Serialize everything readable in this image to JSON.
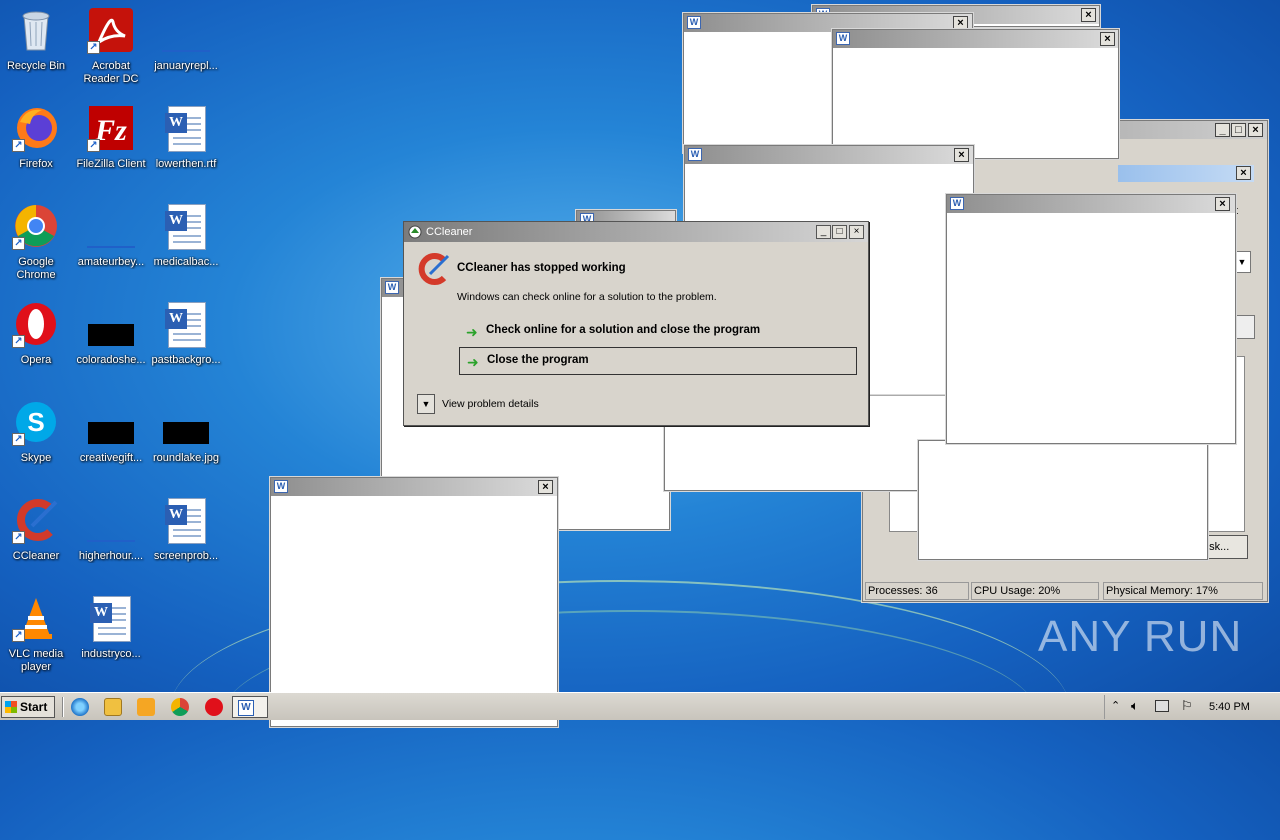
{
  "desktop_icons": [
    {
      "label": "Recycle Bin",
      "icon": "recycle-bin-icon"
    },
    {
      "label": "Acrobat Reader DC",
      "icon": "acrobat-icon"
    },
    {
      "label": "januaryrepl...",
      "icon": "file-icon"
    },
    {
      "label": "Firefox",
      "icon": "firefox-icon"
    },
    {
      "label": "FileZilla Client",
      "icon": "filezilla-icon"
    },
    {
      "label": "lowerthen.rtf",
      "icon": "word-doc-icon"
    },
    {
      "label": "Google Chrome",
      "icon": "chrome-icon"
    },
    {
      "label": "amateurbey...",
      "icon": "file-icon"
    },
    {
      "label": "medicalbac...",
      "icon": "word-doc-icon"
    },
    {
      "label": "Opera",
      "icon": "opera-icon"
    },
    {
      "label": "coloradoshe...",
      "icon": "image-icon"
    },
    {
      "label": "pastbackgro...",
      "icon": "word-doc-icon"
    },
    {
      "label": "Skype",
      "icon": "skype-icon"
    },
    {
      "label": "creativegift...",
      "icon": "image-icon"
    },
    {
      "label": "roundlake.jpg",
      "icon": "image-icon"
    },
    {
      "label": "CCleaner",
      "icon": "ccleaner-icon"
    },
    {
      "label": "higherhour....",
      "icon": "file-icon"
    },
    {
      "label": "screenprob...",
      "icon": "word-doc-icon"
    },
    {
      "label": "VLC media player",
      "icon": "vlc-icon"
    },
    {
      "label": "industryco...",
      "icon": "word-doc-icon"
    }
  ],
  "dialog": {
    "title": "CCleaner",
    "heading": "CCleaner has stopped working",
    "message": "Windows can check online for a solution to the problem.",
    "option1": "Check online for a solution and close the program",
    "option2": "Close the program",
    "details": "View problem details"
  },
  "task_manager": {
    "processes": "Processes: 36",
    "cpu": "CPU Usage: 20%",
    "memory": "Physical Memory: 17%",
    "task_button_partial": "ask...",
    "partial_text": "t"
  },
  "taskbar": {
    "start_label": "Start",
    "clock": "5:40 PM"
  },
  "watermark": "ANY RUN"
}
